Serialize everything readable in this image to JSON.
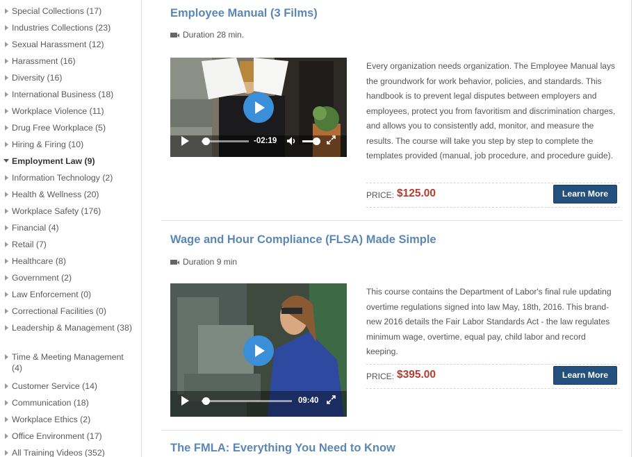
{
  "sidebar": {
    "categories": [
      {
        "label": "Special Collections (17)"
      },
      {
        "label": "Industries Collections (23)"
      },
      {
        "label": "Sexual Harassment (12)"
      },
      {
        "label": "Harassment (16)"
      },
      {
        "label": "Diversity (16)"
      },
      {
        "label": "International Business (18)"
      },
      {
        "label": "Workplace Violence (11)"
      },
      {
        "label": "Drug Free Workplace (5)"
      },
      {
        "label": "Hiring & Firing (10)"
      },
      {
        "label": "Employment Law (9)",
        "active": true
      },
      {
        "label": "Information Technology (2)"
      },
      {
        "label": "Health & Wellness (20)"
      },
      {
        "label": "Workplace Safety (176)"
      },
      {
        "label": "Financial (4)"
      },
      {
        "label": "Retail (7)"
      },
      {
        "label": "Healthcare (8)"
      },
      {
        "label": "Government (2)"
      },
      {
        "label": "Law Enforcement (0)"
      },
      {
        "label": "Correctional Facilities (0)"
      },
      {
        "label": "Leadership & Management (38)"
      },
      {
        "label": "Time & Meeting Management (4)"
      },
      {
        "label": "Customer Service (14)"
      },
      {
        "label": "Communication (18)"
      },
      {
        "label": "Workplace Ethics (2)"
      },
      {
        "label": "Office Environment (17)"
      },
      {
        "label": "All Training Videos (352)"
      }
    ]
  },
  "products": [
    {
      "title": "Employee Manual (3 Films)",
      "duration": "Duration 28 min.",
      "video_time": "-02:19",
      "description": "Every organization needs organization. The Employee Manual lays the groundwork for work behavior, policies, and standards. This handbook is to prevent legal disputes between employers and employees, protect you from favoritism and discrimination charges, and allows you to consistently add, monitor, and measure the results. The course will take you step by step to complete the templates provided (manual, job procedure, and procedure guide).",
      "price_label": "PRICE:",
      "price": "$125.00",
      "button": "Learn More"
    },
    {
      "title": "Wage and Hour Compliance (FLSA) Made Simple",
      "duration": "Duration 9 min",
      "video_time": "09:40",
      "description": "This course contains the Department of Labor's final rule updating overtime regulations signed into law May, 18th, 2016. This brand-new 2016 details the Fair Labor Standards Act - the law regulates minimum wage, overtime, equal pay, child labor and record keeping.",
      "price_label": "PRICE:",
      "price": "$395.00",
      "button": "Learn More"
    },
    {
      "title": "The FMLA: Everything You Need to Know"
    }
  ],
  "colors": {
    "title": "#5b87b5",
    "price": "#b93a2e",
    "button": "#24507e",
    "play": "#3a8fd8"
  }
}
